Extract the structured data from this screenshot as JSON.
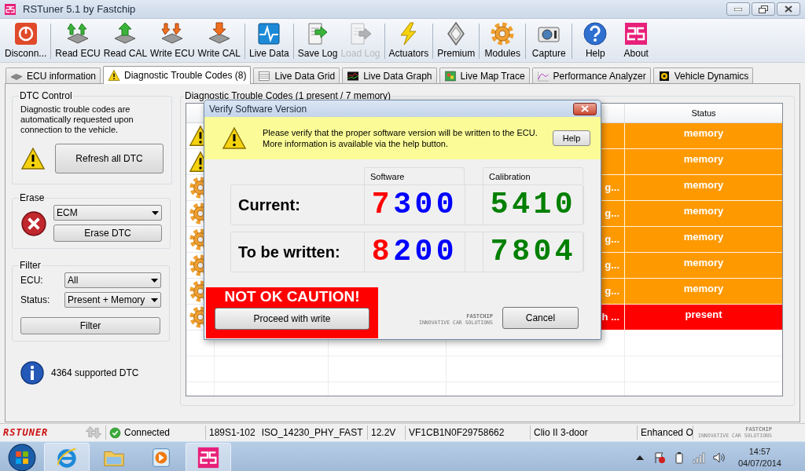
{
  "window": {
    "title": "RSTuner 5.1 by Fastchip"
  },
  "toolbar": {
    "groups": [
      {
        "items": [
          {
            "label": "Disconn...",
            "kind": "power",
            "disabled": false
          }
        ]
      },
      {
        "items": [
          {
            "label": "Read ECU",
            "kind": "read2",
            "disabled": false
          },
          {
            "label": "Read CAL",
            "kind": "read1",
            "disabled": false
          },
          {
            "label": "Write ECU",
            "kind": "write2",
            "disabled": false
          },
          {
            "label": "Write CAL",
            "kind": "write1",
            "disabled": false
          }
        ]
      },
      {
        "items": [
          {
            "label": "Live Data",
            "kind": "pulse",
            "disabled": false
          }
        ]
      },
      {
        "items": [
          {
            "label": "Save Log",
            "kind": "save",
            "disabled": false
          },
          {
            "label": "Load Log",
            "kind": "load",
            "disabled": true
          }
        ]
      },
      {
        "items": [
          {
            "label": "Actuators",
            "kind": "bolt",
            "disabled": false
          }
        ]
      },
      {
        "items": [
          {
            "label": "Premium",
            "kind": "diamond",
            "disabled": false
          }
        ]
      },
      {
        "items": [
          {
            "label": "Modules",
            "kind": "gear",
            "disabled": false
          }
        ]
      },
      {
        "items": [
          {
            "label": "Capture",
            "kind": "camera",
            "disabled": false
          }
        ]
      },
      {
        "items": [
          {
            "label": "Help",
            "kind": "help",
            "disabled": false
          },
          {
            "label": "About",
            "kind": "logo",
            "disabled": false
          }
        ]
      }
    ]
  },
  "tabs": [
    {
      "label": "ECU information",
      "kind": "chip",
      "selected": false
    },
    {
      "label": "Diagnostic Trouble Codes (8)",
      "kind": "warning",
      "selected": true
    },
    {
      "label": "Live Data Grid",
      "kind": "grid",
      "selected": false
    },
    {
      "label": "Live Data Graph",
      "kind": "graph",
      "selected": false
    },
    {
      "label": "Live Map Trace",
      "kind": "map",
      "selected": false
    },
    {
      "label": "Performance Analyzer",
      "kind": "perf",
      "selected": false
    },
    {
      "label": "Vehicle Dynamics",
      "kind": "dyn",
      "selected": false
    }
  ],
  "dtc_control": {
    "title": "DTC Control",
    "description": "Diagnostic trouble codes are automatically requested upon connection to the vehicle.",
    "button": "Refresh all DTC"
  },
  "erase": {
    "title": "Erase",
    "module": "ECM",
    "button": "Erase DTC"
  },
  "filter": {
    "title": "Filter",
    "fields": [
      {
        "label": "ECU:",
        "value": "All"
      },
      {
        "label": "Status:",
        "value": "Present + Memory"
      }
    ],
    "button": "Filter"
  },
  "info": "4364 supported DTC",
  "dtc_table": {
    "title": "Diagnostic Trouble Codes (1 present / 7 memory)",
    "status_header": "Status",
    "rows": [
      {
        "kind": "warning",
        "status": "memory",
        "color": "#ff9900"
      },
      {
        "kind": "warning",
        "status": "memory",
        "color": "#ff9900"
      },
      {
        "kind": "gear",
        "column_4": "g...",
        "status": "memory",
        "color": "#ff9900"
      },
      {
        "kind": "gear",
        "column_4": "g...",
        "status": "memory",
        "color": "#ff9900"
      },
      {
        "kind": "gear",
        "column_4": "g...",
        "status": "memory",
        "color": "#ff9900"
      },
      {
        "kind": "gear",
        "column_4": "g...",
        "status": "memory",
        "color": "#ff9900"
      },
      {
        "kind": "gear",
        "column_4": "g...",
        "status": "memory",
        "color": "#ff9900"
      },
      {
        "kind": "gear",
        "column_4": "h ...",
        "status": "present",
        "color": "#ff0000"
      }
    ]
  },
  "dialog": {
    "title": "Verify Software Version",
    "message": [
      "Please verify that the proper software version will be written to the ECU.",
      "More information is available via the help button."
    ],
    "help_button": "Help",
    "columns": [
      {
        "label": "Software",
        "color": "#0000ff",
        "lead_digit": {
          "color": "#ff0000"
        }
      },
      {
        "label": "Calibration",
        "color": "#008000"
      }
    ],
    "rows": [
      {
        "label": "Current:",
        "values": [
          "7300",
          "5410"
        ]
      },
      {
        "label": "To be written:",
        "values": [
          "8200",
          "7804"
        ]
      }
    ],
    "warning": "NOT OK CAUTION!",
    "proceed_button": "Proceed with write",
    "brand": "FASTCHIP",
    "tagline": "INNOVATIVE CAR SOLUTIONS",
    "cancel_button": "Cancel"
  },
  "status_bar": {
    "logo": "RSTUNER",
    "connection": "Connected",
    "cells": [
      {
        "texts": [
          "189S1-102",
          "ISO_14230_PHY_FAST"
        ]
      },
      {
        "texts": [
          "12.2V"
        ]
      },
      {
        "texts": [
          "VF1CB1N0F29758662"
        ]
      },
      {
        "texts": [
          "Clio II 3-door"
        ]
      },
      {
        "texts": [
          "Enhanced O"
        ]
      }
    ],
    "brand": "FASTCHIP",
    "tagline": "INNOVATIVE CAR SOLUTIONS"
  },
  "taskbar": {
    "apps": [
      {
        "kind": "ie",
        "running": true
      },
      {
        "kind": "folder",
        "running": false
      },
      {
        "kind": "media",
        "running": false
      },
      {
        "kind": "logo",
        "running": true
      }
    ],
    "time": "14:57",
    "date": "04/07/2014"
  }
}
